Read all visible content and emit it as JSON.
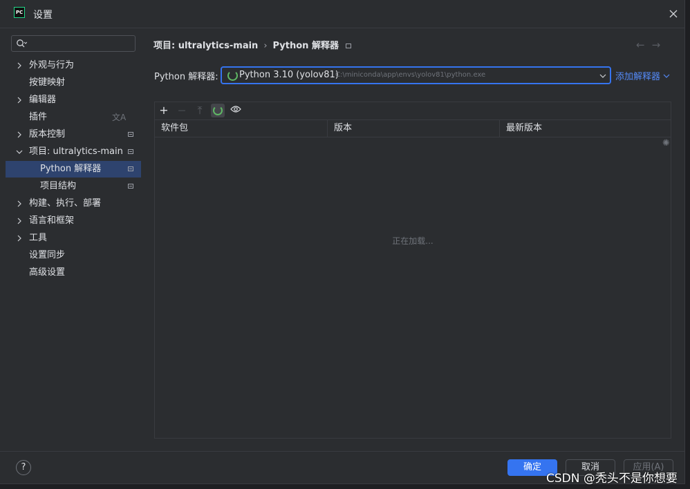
{
  "window": {
    "title": "设置",
    "app_icon_text": "PC"
  },
  "sidebar": {
    "search_placeholder": "",
    "items": [
      {
        "label": "外观与行为",
        "expandable": true
      },
      {
        "label": "按键映射",
        "expandable": false
      },
      {
        "label": "编辑器",
        "expandable": true
      },
      {
        "label": "插件",
        "expandable": false
      },
      {
        "label": "版本控制",
        "expandable": true
      },
      {
        "label": "项目: ultralytics-main",
        "expandable": true,
        "expanded": true
      },
      {
        "label": "Python 解释器",
        "child": true,
        "selected": true
      },
      {
        "label": "项目结构",
        "child": true
      },
      {
        "label": "构建、执行、部署",
        "expandable": true
      },
      {
        "label": "语言和框架",
        "expandable": true
      },
      {
        "label": "工具",
        "expandable": true
      },
      {
        "label": "设置同步",
        "expandable": false
      },
      {
        "label": "高级设置",
        "expandable": false
      }
    ]
  },
  "breadcrumb": {
    "project": "项目: ultralytics-main",
    "separator": "›",
    "page": "Python 解释器"
  },
  "interpreter": {
    "label": "Python 解释器:",
    "name": "Python 3.10 (yolov81)",
    "path": "C:\\miniconda\\app\\envs\\yolov81\\python.exe",
    "add_label": "添加解释器"
  },
  "packages": {
    "toolbar": {
      "add": "+",
      "remove": "—",
      "upgrade": "⤒",
      "show": "◉"
    },
    "columns": [
      "软件包",
      "版本",
      "最新版本"
    ],
    "loading_text": "正在加载..."
  },
  "footer": {
    "help": "?",
    "ok": "确定",
    "cancel": "取消",
    "apply": "应用(A)"
  },
  "watermark": "CSDN @秃头不是你想要",
  "colors": {
    "accent": "#3574f0",
    "selection": "#2e436e",
    "link": "#548af7",
    "background": "#2b2d30"
  }
}
